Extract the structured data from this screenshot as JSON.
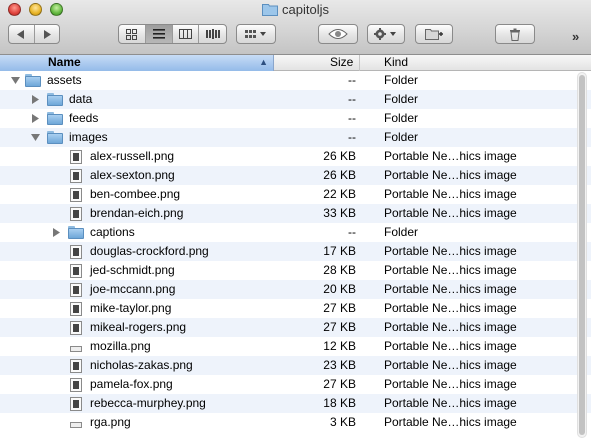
{
  "window": {
    "title": "capitoljs"
  },
  "toolbar": {
    "back_icon": "back-arrow-icon",
    "forward_icon": "forward-arrow-icon",
    "view_modes": [
      "icon-view-icon",
      "list-view-icon",
      "column-view-icon",
      "coverflow-view-icon"
    ],
    "active_view": "list-view-icon",
    "overflow": "»"
  },
  "columns": {
    "name": "Name",
    "size": "Size",
    "kind": "Kind"
  },
  "rows": [
    {
      "name": "assets",
      "size": "--",
      "kind": "Folder",
      "type": "folder",
      "depth": 0,
      "expanded": true
    },
    {
      "name": "data",
      "size": "--",
      "kind": "Folder",
      "type": "folder",
      "depth": 1,
      "expanded": false
    },
    {
      "name": "feeds",
      "size": "--",
      "kind": "Folder",
      "type": "folder",
      "depth": 1,
      "expanded": false
    },
    {
      "name": "images",
      "size": "--",
      "kind": "Folder",
      "type": "folder",
      "depth": 1,
      "expanded": true
    },
    {
      "name": "alex-russell.png",
      "size": "26 KB",
      "kind": "Portable Ne…hics image",
      "type": "image",
      "depth": 2
    },
    {
      "name": "alex-sexton.png",
      "size": "26 KB",
      "kind": "Portable Ne…hics image",
      "type": "image",
      "depth": 2
    },
    {
      "name": "ben-combee.png",
      "size": "22 KB",
      "kind": "Portable Ne…hics image",
      "type": "image",
      "depth": 2
    },
    {
      "name": "brendan-eich.png",
      "size": "33 KB",
      "kind": "Portable Ne…hics image",
      "type": "image",
      "depth": 2
    },
    {
      "name": "captions",
      "size": "--",
      "kind": "Folder",
      "type": "folder",
      "depth": 2,
      "expanded": false
    },
    {
      "name": "douglas-crockford.png",
      "size": "17 KB",
      "kind": "Portable Ne…hics image",
      "type": "image",
      "depth": 2
    },
    {
      "name": "jed-schmidt.png",
      "size": "28 KB",
      "kind": "Portable Ne…hics image",
      "type": "image",
      "depth": 2
    },
    {
      "name": "joe-mccann.png",
      "size": "20 KB",
      "kind": "Portable Ne…hics image",
      "type": "image",
      "depth": 2
    },
    {
      "name": "mike-taylor.png",
      "size": "27 KB",
      "kind": "Portable Ne…hics image",
      "type": "image",
      "depth": 2
    },
    {
      "name": "mikeal-rogers.png",
      "size": "27 KB",
      "kind": "Portable Ne…hics image",
      "type": "image",
      "depth": 2
    },
    {
      "name": "mozilla.png",
      "size": "12 KB",
      "kind": "Portable Ne…hics image",
      "type": "image-blank",
      "depth": 2
    },
    {
      "name": "nicholas-zakas.png",
      "size": "23 KB",
      "kind": "Portable Ne…hics image",
      "type": "image",
      "depth": 2
    },
    {
      "name": "pamela-fox.png",
      "size": "27 KB",
      "kind": "Portable Ne…hics image",
      "type": "image",
      "depth": 2
    },
    {
      "name": "rebecca-murphey.png",
      "size": "18 KB",
      "kind": "Portable Ne…hics image",
      "type": "image",
      "depth": 2
    },
    {
      "name": "rga.png",
      "size": "3 KB",
      "kind": "Portable Ne…hics image",
      "type": "image-blank",
      "depth": 2
    }
  ]
}
